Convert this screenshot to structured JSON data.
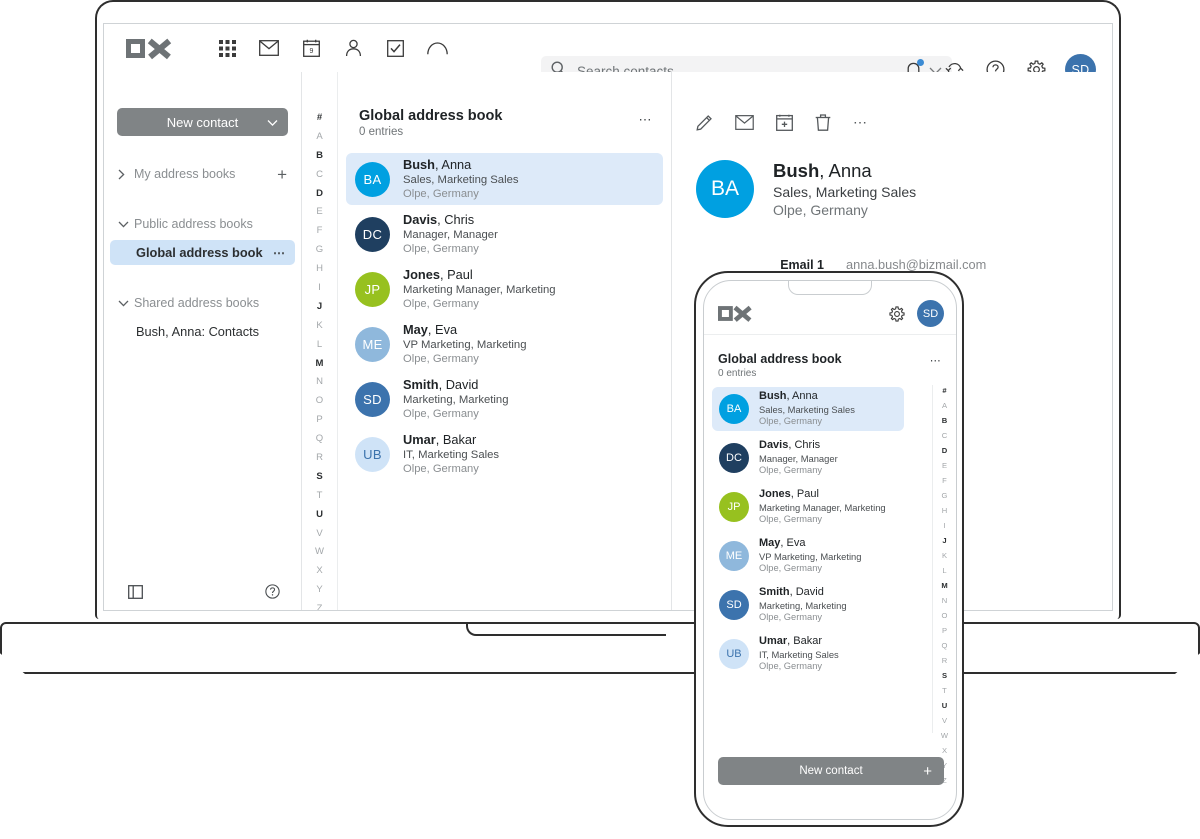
{
  "app": {
    "logo_text": "OX",
    "accent_blue": "#00a0e1",
    "selected_row_bg": "#ddeaf9",
    "nav_selected_bg": "#cfe3f7",
    "button_grey": "#808486"
  },
  "topbar": {
    "app_icons": [
      {
        "name": "app-grid-icon",
        "label": "Portal"
      },
      {
        "name": "mail-icon",
        "label": "Mail"
      },
      {
        "name": "calendar-icon",
        "label": "Calendar"
      },
      {
        "name": "contacts-icon",
        "label": "Address Book"
      },
      {
        "name": "tasks-icon",
        "label": "Tasks"
      },
      {
        "name": "drive-icon",
        "label": "Drive"
      }
    ],
    "right_icons": [
      {
        "name": "bell-icon",
        "label": "Notifications",
        "badge": true
      },
      {
        "name": "refresh-icon",
        "label": "Refresh"
      },
      {
        "name": "help-icon",
        "label": "Help"
      },
      {
        "name": "gear-icon",
        "label": "Settings"
      }
    ],
    "avatar_initials": "SD"
  },
  "search": {
    "placeholder": "Search contacts",
    "value": ""
  },
  "sidebar": {
    "new_contact_label": "New contact",
    "groups": [
      {
        "label": "My address books",
        "expanded": false,
        "has_add": true,
        "items": []
      },
      {
        "label": "Public address books",
        "expanded": true,
        "has_add": false,
        "items": [
          {
            "label": "Global address book",
            "selected": true,
            "dots": "⋯"
          }
        ]
      },
      {
        "label": "Shared address books",
        "expanded": true,
        "has_add": false,
        "items": [
          {
            "label": "Bush, Anna: Contacts",
            "selected": false
          }
        ]
      }
    ],
    "footer": [
      {
        "name": "toggle-folderview-icon",
        "label": "Toggle folder view"
      },
      {
        "name": "help-icon",
        "label": "Help"
      }
    ]
  },
  "list": {
    "title": "Global address book",
    "subtitle": "0 entries",
    "options_label": "⋯",
    "alphabet": [
      {
        "ch": "#",
        "active": true
      },
      {
        "ch": "A",
        "active": false
      },
      {
        "ch": "B",
        "active": true
      },
      {
        "ch": "C",
        "active": false
      },
      {
        "ch": "D",
        "active": true
      },
      {
        "ch": "E",
        "active": false
      },
      {
        "ch": "F",
        "active": false
      },
      {
        "ch": "G",
        "active": false
      },
      {
        "ch": "H",
        "active": false
      },
      {
        "ch": "I",
        "active": false
      },
      {
        "ch": "J",
        "active": true
      },
      {
        "ch": "K",
        "active": false
      },
      {
        "ch": "L",
        "active": false
      },
      {
        "ch": "M",
        "active": true
      },
      {
        "ch": "N",
        "active": false
      },
      {
        "ch": "O",
        "active": false
      },
      {
        "ch": "P",
        "active": false
      },
      {
        "ch": "Q",
        "active": false
      },
      {
        "ch": "R",
        "active": false
      },
      {
        "ch": "S",
        "active": true
      },
      {
        "ch": "T",
        "active": false
      },
      {
        "ch": "U",
        "active": true
      },
      {
        "ch": "V",
        "active": false
      },
      {
        "ch": "W",
        "active": false
      },
      {
        "ch": "X",
        "active": false
      },
      {
        "ch": "Y",
        "active": false
      },
      {
        "ch": "Z",
        "active": false
      }
    ],
    "contacts": [
      {
        "initials": "BA",
        "color": "#00a0e1",
        "last": "Bush",
        "first": "Anna",
        "role": "Sales, Marketing Sales",
        "location": "Olpe, Germany",
        "selected": true
      },
      {
        "initials": "DC",
        "color": "#1f3f60",
        "last": "Davis",
        "first": "Chris",
        "role": "Manager, Manager",
        "location": "Olpe, Germany",
        "selected": false
      },
      {
        "initials": "JP",
        "color": "#97c11f",
        "last": "Jones",
        "first": "Paul",
        "role": "Marketing Manager, Marketing",
        "location": "Olpe, Germany",
        "selected": false
      },
      {
        "initials": "ME",
        "color": "#8fb8dc",
        "last": "May",
        "first": "Eva",
        "role": "VP Marketing, Marketing",
        "location": "Olpe, Germany",
        "selected": false
      },
      {
        "initials": "SD",
        "color": "#3c73ad",
        "last": "Smith",
        "first": "David",
        "role": "Marketing, Marketing",
        "location": "Olpe, Germany",
        "selected": false
      },
      {
        "initials": "UB",
        "color": "#cfe3f7",
        "last": "Umar",
        "first": "Bakar",
        "role": "IT, Marketing Sales",
        "location": "Olpe, Germany",
        "selected": false
      }
    ]
  },
  "detail": {
    "toolbar": [
      {
        "name": "edit-pencil-icon",
        "label": "Edit"
      },
      {
        "name": "mail-icon",
        "label": "Send mail"
      },
      {
        "name": "add-appointment-icon",
        "label": "Invite to appointment"
      },
      {
        "name": "trash-icon",
        "label": "Delete"
      },
      {
        "name": "more-options-icon",
        "label": "⋯"
      }
    ],
    "avatar_initials": "BA",
    "avatar_color": "#00a0e1",
    "last_name": "Bush",
    "first_name": "Anna",
    "role": "Sales, Marketing Sales",
    "location": "Olpe, Germany",
    "fields": [
      {
        "label": "Email 1",
        "value": "anna.bush@bizmail.com"
      }
    ]
  },
  "phone": {
    "logo_text": "OX",
    "gear_label": "Settings",
    "avatar_initials": "SD",
    "list_title": "Global address book",
    "list_subtitle": "0 entries",
    "options_label": "⋯",
    "new_contact_label": "New contact",
    "new_contact_plus": "+",
    "alphabet": [
      {
        "ch": "#",
        "active": true
      },
      {
        "ch": "A",
        "active": false
      },
      {
        "ch": "B",
        "active": true
      },
      {
        "ch": "C",
        "active": false
      },
      {
        "ch": "D",
        "active": true
      },
      {
        "ch": "E",
        "active": false
      },
      {
        "ch": "F",
        "active": false
      },
      {
        "ch": "G",
        "active": false
      },
      {
        "ch": "H",
        "active": false
      },
      {
        "ch": "I",
        "active": false
      },
      {
        "ch": "J",
        "active": true
      },
      {
        "ch": "K",
        "active": false
      },
      {
        "ch": "L",
        "active": false
      },
      {
        "ch": "M",
        "active": true
      },
      {
        "ch": "N",
        "active": false
      },
      {
        "ch": "O",
        "active": false
      },
      {
        "ch": "P",
        "active": false
      },
      {
        "ch": "Q",
        "active": false
      },
      {
        "ch": "R",
        "active": false
      },
      {
        "ch": "S",
        "active": true
      },
      {
        "ch": "T",
        "active": false
      },
      {
        "ch": "U",
        "active": true
      },
      {
        "ch": "V",
        "active": false
      },
      {
        "ch": "W",
        "active": false
      },
      {
        "ch": "X",
        "active": false
      },
      {
        "ch": "Y",
        "active": false
      },
      {
        "ch": "Z",
        "active": false
      }
    ],
    "contacts": [
      {
        "initials": "BA",
        "color": "#00a0e1",
        "last": "Bush",
        "first": "Anna",
        "role": "Sales, Marketing Sales",
        "location": "Olpe, Germany",
        "selected": true
      },
      {
        "initials": "DC",
        "color": "#1f3f60",
        "last": "Davis",
        "first": "Chris",
        "role": "Manager, Manager",
        "location": "Olpe, Germany",
        "selected": false
      },
      {
        "initials": "JP",
        "color": "#97c11f",
        "last": "Jones",
        "first": "Paul",
        "role": "Marketing Manager, Marketing",
        "location": "Olpe, Germany",
        "selected": false
      },
      {
        "initials": "ME",
        "color": "#8fb8dc",
        "last": "May",
        "first": "Eva",
        "role": "VP Marketing, Marketing",
        "location": "Olpe, Germany",
        "selected": false
      },
      {
        "initials": "SD",
        "color": "#3c73ad",
        "last": "Smith",
        "first": "David",
        "role": "Marketing, Marketing",
        "location": "Olpe, Germany",
        "selected": false
      },
      {
        "initials": "UB",
        "color": "#cfe3f7",
        "last": "Umar",
        "first": "Bakar",
        "role": "IT, Marketing Sales",
        "location": "Olpe, Germany",
        "selected": false
      }
    ]
  }
}
